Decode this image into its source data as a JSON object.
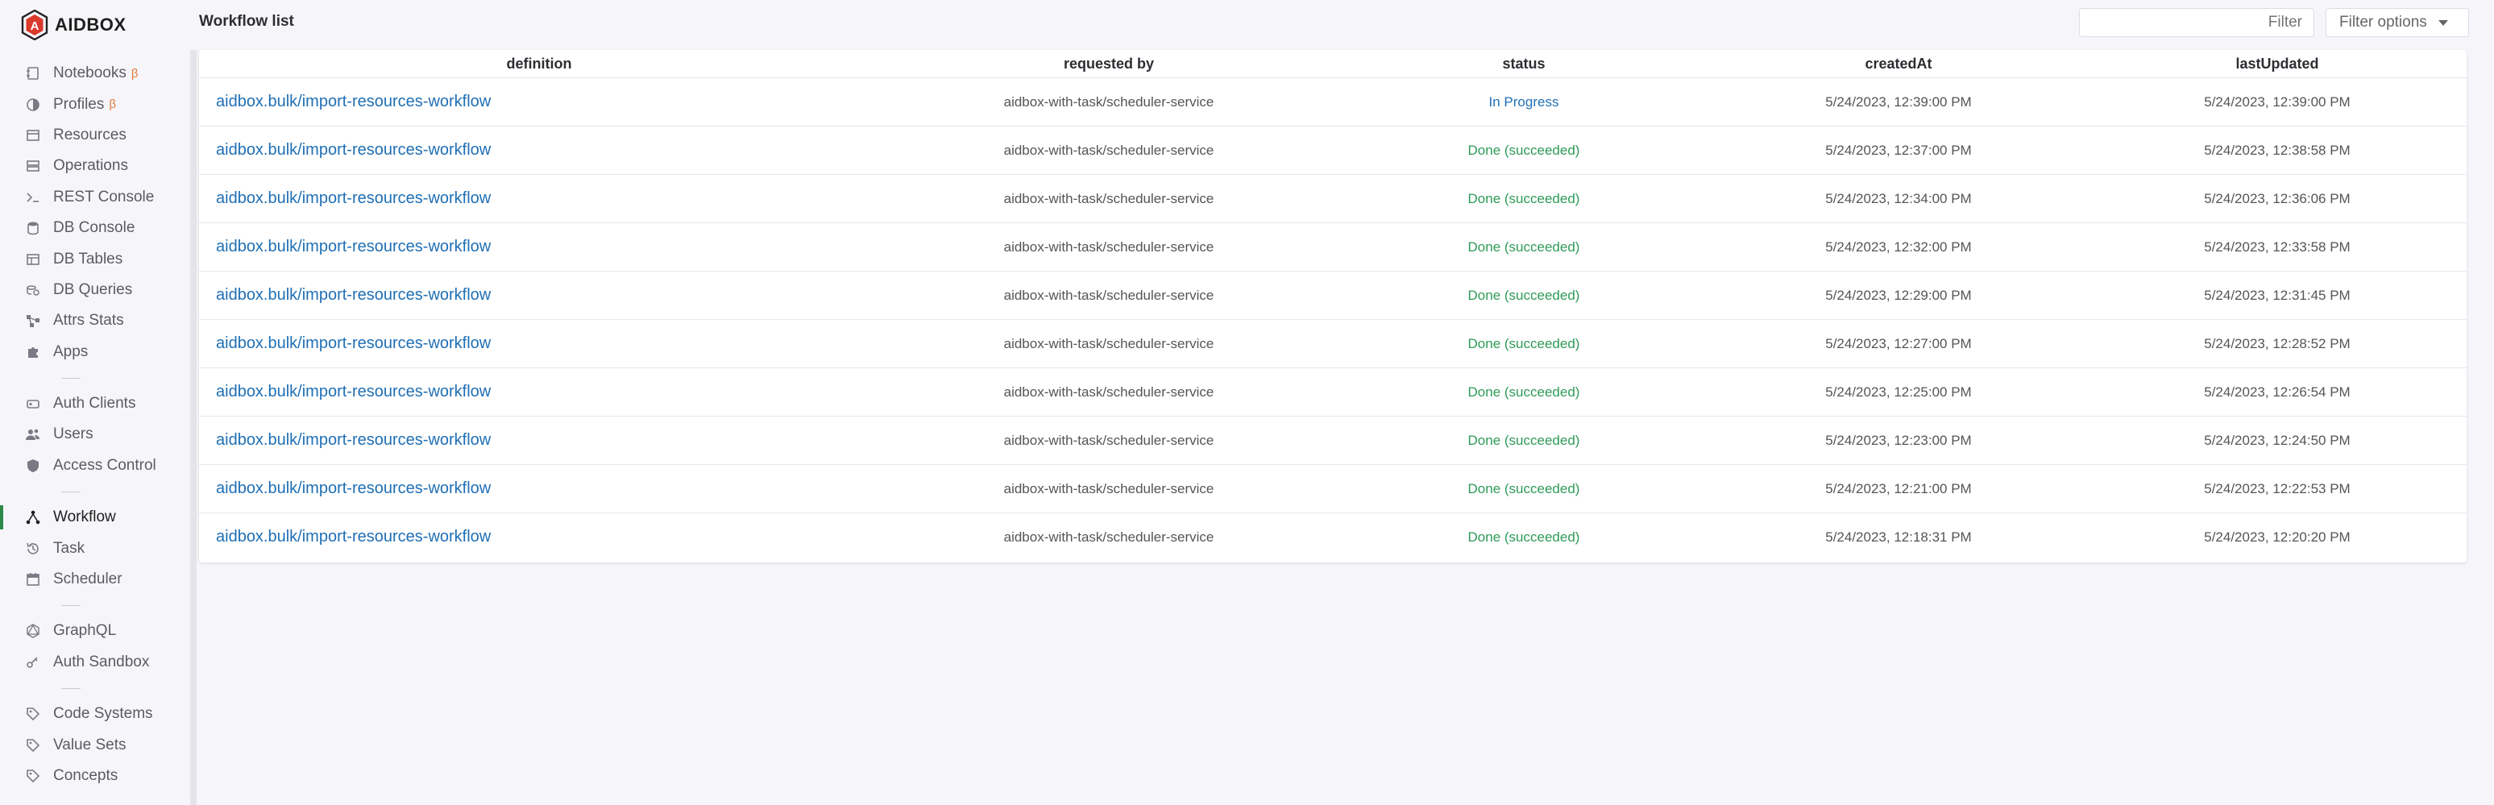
{
  "app": {
    "name": "AIDBOX"
  },
  "sidebar": {
    "groups": [
      [
        {
          "label": "Notebooks",
          "icon": "notebooks-icon",
          "beta": true
        },
        {
          "label": "Profiles",
          "icon": "profiles-icon",
          "beta": true
        },
        {
          "label": "Resources",
          "icon": "resources-icon"
        },
        {
          "label": "Operations",
          "icon": "operations-icon"
        },
        {
          "label": "REST Console",
          "icon": "terminal-icon"
        },
        {
          "label": "DB Console",
          "icon": "database-icon"
        },
        {
          "label": "DB Tables",
          "icon": "table-icon"
        },
        {
          "label": "DB Queries",
          "icon": "queries-icon"
        },
        {
          "label": "Attrs Stats",
          "icon": "stats-icon"
        },
        {
          "label": "Apps",
          "icon": "puzzle-icon"
        }
      ],
      [
        {
          "label": "Auth Clients",
          "icon": "clients-icon"
        },
        {
          "label": "Users",
          "icon": "users-icon"
        },
        {
          "label": "Access Control",
          "icon": "shield-icon"
        }
      ],
      [
        {
          "label": "Workflow",
          "icon": "workflow-icon",
          "active": true
        },
        {
          "label": "Task",
          "icon": "history-icon"
        },
        {
          "label": "Scheduler",
          "icon": "calendar-icon"
        }
      ],
      [
        {
          "label": "GraphQL",
          "icon": "graphql-icon"
        },
        {
          "label": "Auth Sandbox",
          "icon": "key-icon"
        }
      ],
      [
        {
          "label": "Code Systems",
          "icon": "tag-icon"
        },
        {
          "label": "Value Sets",
          "icon": "tag-icon"
        },
        {
          "label": "Concepts",
          "icon": "tag-icon"
        }
      ]
    ]
  },
  "header": {
    "title": "Workflow list",
    "filter_placeholder": "Filter",
    "filter_options_label": "Filter options"
  },
  "table": {
    "columns": [
      "definition",
      "requested by",
      "status",
      "createdAt",
      "lastUpdated"
    ],
    "rows": [
      {
        "definition": "aidbox.bulk/import-resources-workflow",
        "requested_by": "aidbox-with-task/scheduler-service",
        "status": "In Progress",
        "status_kind": "progress",
        "createdAt": "5/24/2023, 12:39:00 PM",
        "lastUpdated": "5/24/2023, 12:39:00 PM"
      },
      {
        "definition": "aidbox.bulk/import-resources-workflow",
        "requested_by": "aidbox-with-task/scheduler-service",
        "status": "Done (succeeded)",
        "status_kind": "done",
        "createdAt": "5/24/2023, 12:37:00 PM",
        "lastUpdated": "5/24/2023, 12:38:58 PM"
      },
      {
        "definition": "aidbox.bulk/import-resources-workflow",
        "requested_by": "aidbox-with-task/scheduler-service",
        "status": "Done (succeeded)",
        "status_kind": "done",
        "createdAt": "5/24/2023, 12:34:00 PM",
        "lastUpdated": "5/24/2023, 12:36:06 PM"
      },
      {
        "definition": "aidbox.bulk/import-resources-workflow",
        "requested_by": "aidbox-with-task/scheduler-service",
        "status": "Done (succeeded)",
        "status_kind": "done",
        "createdAt": "5/24/2023, 12:32:00 PM",
        "lastUpdated": "5/24/2023, 12:33:58 PM"
      },
      {
        "definition": "aidbox.bulk/import-resources-workflow",
        "requested_by": "aidbox-with-task/scheduler-service",
        "status": "Done (succeeded)",
        "status_kind": "done",
        "createdAt": "5/24/2023, 12:29:00 PM",
        "lastUpdated": "5/24/2023, 12:31:45 PM"
      },
      {
        "definition": "aidbox.bulk/import-resources-workflow",
        "requested_by": "aidbox-with-task/scheduler-service",
        "status": "Done (succeeded)",
        "status_kind": "done",
        "createdAt": "5/24/2023, 12:27:00 PM",
        "lastUpdated": "5/24/2023, 12:28:52 PM"
      },
      {
        "definition": "aidbox.bulk/import-resources-workflow",
        "requested_by": "aidbox-with-task/scheduler-service",
        "status": "Done (succeeded)",
        "status_kind": "done",
        "createdAt": "5/24/2023, 12:25:00 PM",
        "lastUpdated": "5/24/2023, 12:26:54 PM"
      },
      {
        "definition": "aidbox.bulk/import-resources-workflow",
        "requested_by": "aidbox-with-task/scheduler-service",
        "status": "Done (succeeded)",
        "status_kind": "done",
        "createdAt": "5/24/2023, 12:23:00 PM",
        "lastUpdated": "5/24/2023, 12:24:50 PM"
      },
      {
        "definition": "aidbox.bulk/import-resources-workflow",
        "requested_by": "aidbox-with-task/scheduler-service",
        "status": "Done (succeeded)",
        "status_kind": "done",
        "createdAt": "5/24/2023, 12:21:00 PM",
        "lastUpdated": "5/24/2023, 12:22:53 PM"
      },
      {
        "definition": "aidbox.bulk/import-resources-workflow",
        "requested_by": "aidbox-with-task/scheduler-service",
        "status": "Done (succeeded)",
        "status_kind": "done",
        "createdAt": "5/24/2023, 12:18:31 PM",
        "lastUpdated": "5/24/2023, 12:20:20 PM"
      }
    ]
  },
  "colors": {
    "link": "#1f6fb5",
    "done": "#2e9a57",
    "active_marker": "#2b8a4a",
    "beta": "#e07b3c"
  }
}
